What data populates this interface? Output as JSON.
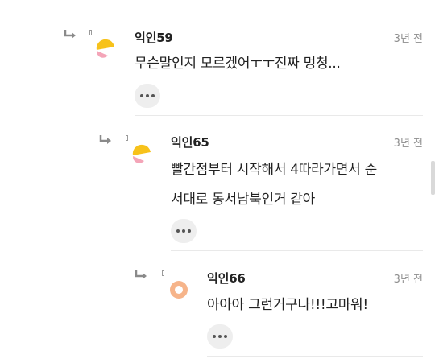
{
  "comments": [
    {
      "nickname": "익인59",
      "time": "3년 전",
      "text": "무슨말인지 모르겠어ㅜㅜ진짜 멍청...",
      "avatar": {
        "colors": [
          "#f7c21b",
          "#f4a5b8"
        ]
      }
    },
    {
      "nickname": "익인65",
      "time": "3년 전",
      "lines": [
        "빨간점부터 시작해서 4따라가면서 순",
        "서대로 동서남북인거 같아"
      ],
      "avatar": {
        "colors": [
          "#f7c21b",
          "#f4a5b8"
        ]
      }
    },
    {
      "nickname": "익인66",
      "time": "3년 전",
      "text": "아아아 그런거구나!!!고마워!",
      "avatar": {
        "colors": [
          "#f6b48a",
          "#ffffff"
        ]
      }
    }
  ],
  "icons": {
    "reply": "reply-arrow-icon",
    "more": "more-options-icon"
  },
  "colors": {
    "text": "#222222",
    "muted": "#8e8e8e",
    "button_bg": "#eeeeee",
    "divider": "#e9e9e9"
  }
}
